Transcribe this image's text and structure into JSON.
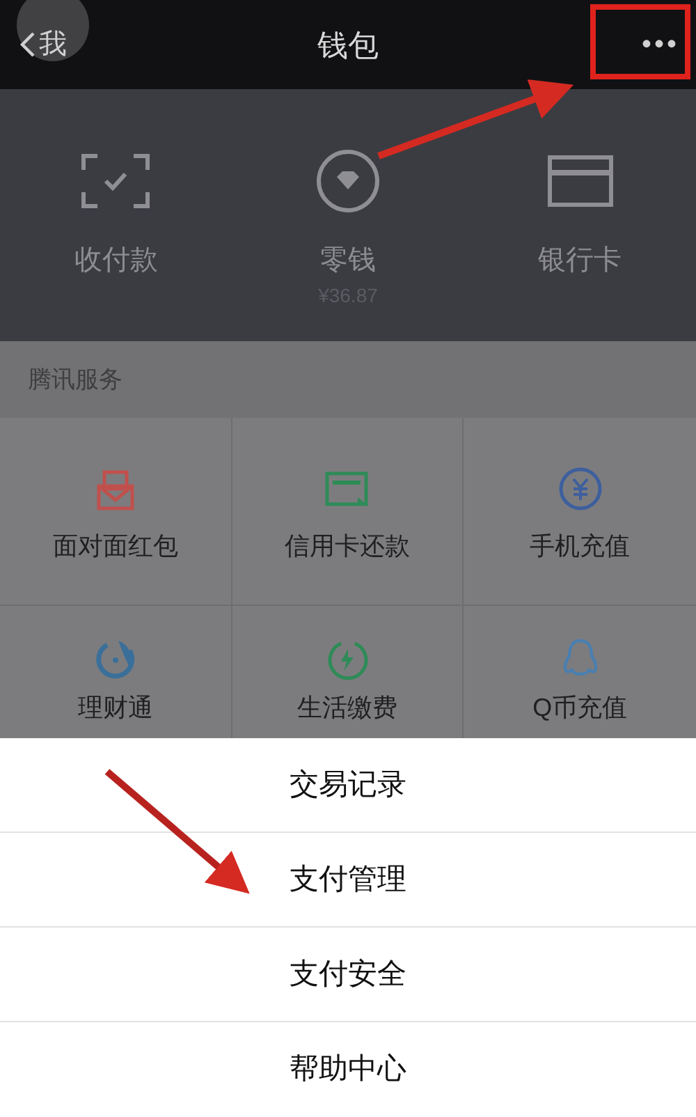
{
  "nav": {
    "back_label": "我",
    "title": "钱包",
    "more": "•••"
  },
  "wallet": [
    {
      "kind": "scan",
      "label": "收付款"
    },
    {
      "kind": "diamond",
      "label": "零钱",
      "amount": "¥36.87"
    },
    {
      "kind": "card",
      "label": "银行卡"
    }
  ],
  "services": {
    "title": "腾讯服务",
    "items": [
      {
        "kind": "redpacket",
        "label": "面对面红包",
        "color": "#c0504d"
      },
      {
        "kind": "creditcard",
        "label": "信用卡还款",
        "color": "#2e8b57"
      },
      {
        "kind": "yen",
        "label": "手机充值",
        "color": "#3d5f9e"
      },
      {
        "kind": "fish",
        "label": "理财通",
        "color": "#3a6f9a"
      },
      {
        "kind": "bolt",
        "label": "生活缴费",
        "color": "#2e8b57"
      },
      {
        "kind": "penguin",
        "label": "Q币充值",
        "color": "#4a7fb0"
      }
    ]
  },
  "action_sheet": [
    "交易记录",
    "支付管理",
    "支付安全",
    "帮助中心"
  ]
}
